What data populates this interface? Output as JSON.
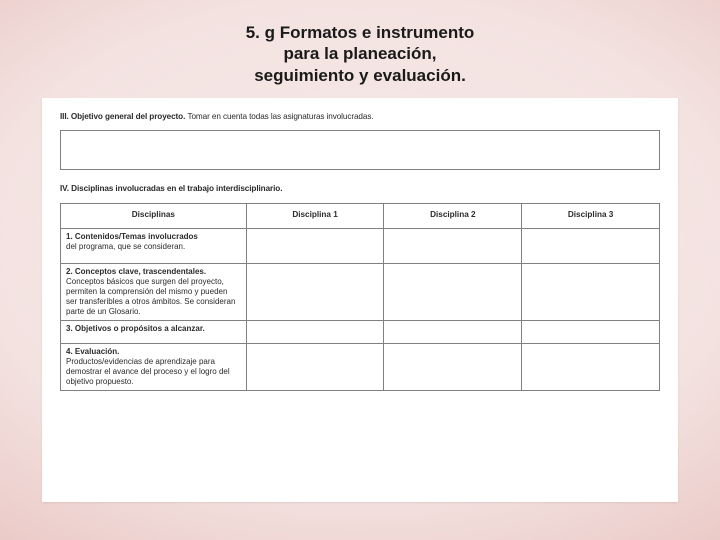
{
  "title": {
    "lead": "5. g",
    "rest_line1": "Formatos e instrumento",
    "rest_line2": "para la planeación,",
    "rest_line3": "seguimiento y evaluación."
  },
  "sectionIII": {
    "heading_bold": "III. Objetivo general del proyecto.",
    "heading_rest": "Tomar en cuenta todas las asignaturas involucradas."
  },
  "sectionIV": {
    "heading": "IV. Disciplinas involucradas en el trabajo interdisciplinario.",
    "headers": {
      "col0": "Disciplinas",
      "col1": "Disciplina 1",
      "col2": "Disciplina 2",
      "col3": "Disciplina 3"
    },
    "rows": {
      "r1_title": "1. Contenidos/Temas involucrados",
      "r1_desc": "del programa, que se consideran.",
      "r2_title": "2. Conceptos clave, trascendentales.",
      "r2_desc": "Conceptos básicos que surgen del proyecto, permiten la comprensión del mismo y pueden ser transferibles a otros ámbitos.\nSe consideran parte de un Glosario.",
      "r3_title": "3. Objetivos o propósitos a alcanzar.",
      "r3_desc": "",
      "r4_title": "4. Evaluación.",
      "r4_desc": "Productos/evidencias de aprendizaje para demostrar el avance del proceso y el logro del objetivo propuesto."
    }
  }
}
